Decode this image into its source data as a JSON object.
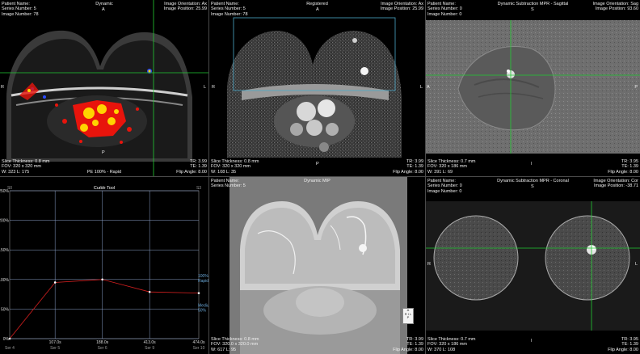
{
  "viewports": {
    "dynamic": {
      "title": "Dynamic",
      "tl": [
        "Patient Name:",
        "Series Number: 5",
        "Image Number: 78"
      ],
      "tr": [
        "Image Orientation: Ax",
        "Image Position: 25.99"
      ],
      "bl": [
        "Slice Thickness: 0.8 mm",
        "FOV: 320 x 320 mm",
        "W: 323  L: 175"
      ],
      "br": [
        "TR: 3.99",
        "TE: 1.39",
        "Flip Angle: 8.00"
      ],
      "bottom_center": "PE 100% - Rapid",
      "orient": {
        "top": "A",
        "bottom": "P",
        "left": "R",
        "right": "L"
      }
    },
    "registered": {
      "title": "Registered",
      "tl": [
        "Patient Name:",
        "Series Number: 5",
        "Image Number: 78"
      ],
      "tr": [
        "Image Orientation: Ax",
        "Image Position: 25.99"
      ],
      "bl": [
        "Slice Thickness: 0.8 mm",
        "FOV: 320 x 320 mm",
        "W: 108  L: 35"
      ],
      "br": [
        "TR: 3.99",
        "TE: 1.39",
        "Flip Angle: 8.00"
      ],
      "orient": {
        "top": "A",
        "bottom": "P",
        "left": "R",
        "right": "L"
      }
    },
    "sagittal": {
      "title": "Dynamic Subtraction MPR - Sagittal",
      "tl": [
        "Patient Name:",
        "Series Number: 0",
        "Image Number: 0"
      ],
      "tr": [
        "Image Orientation: Sag",
        "Image Position: 93.60"
      ],
      "bl": [
        "Slice Thickness: 0.7 mm",
        "FOV: 320 x 186 mm",
        "W: 391  L: 69"
      ],
      "br": [
        "TR: 3.95",
        "TE: 1.39",
        "Flip Angle: 8.00"
      ],
      "orient": {
        "top": "S",
        "bottom": "I",
        "left": "A",
        "right": "P"
      }
    },
    "curve": {
      "title": "Curve Tool",
      "legend_rapid": [
        "100%",
        "Rapid"
      ],
      "legend_medium": [
        "Medium",
        "50%"
      ]
    },
    "mip": {
      "title": "Dynamic MIP",
      "tl": [
        "Patient Name:",
        "Series Number: 5"
      ],
      "bl": [
        "Slice Thickness: 0.8 mm",
        "FOV: 320.0 x 320.0 mm",
        "W: 617  L: 95"
      ],
      "br": [
        "TR: 3.99",
        "TE: 1.39",
        "Flip Angle: 8.00"
      ],
      "cube": {
        "top": "A",
        "left": "R",
        "right": "L",
        "bottom": "P",
        "center": "I"
      }
    },
    "coronal": {
      "title": "Dynamic Subtraction MPR - Coronal",
      "tl": [
        "Patient Name:",
        "Series Number: 0",
        "Image Number: 0"
      ],
      "tr": [
        "Image Orientation: Cor",
        "Image Position: -38.71"
      ],
      "bl": [
        "Slice Thickness: 0.7 mm",
        "FOV: 320 x 186 mm",
        "W: 370  L: 108"
      ],
      "br": [
        "TR: 3.95",
        "TE: 1.39",
        "Flip Angle: 8.00"
      ],
      "orient": {
        "top": "S",
        "bottom": "I",
        "left": "R",
        "right": "L"
      }
    }
  },
  "chart_data": {
    "type": "line",
    "title": "Curve Tool",
    "x_labels": [
      {
        "time": "",
        "series": "Ser 4"
      },
      {
        "time": "107.0s",
        "series": "Ser 5"
      },
      {
        "time": "188.0s",
        "series": "Ser 6"
      },
      {
        "time": "413.0s",
        "series": "Ser 9"
      },
      {
        "time": "474.0s",
        "series": "Ser 10"
      }
    ],
    "top_labels": [
      "S0",
      "S1",
      "S3"
    ],
    "y_ticks": [
      "250%",
      "200%",
      "150%",
      "100%",
      "50%",
      "0%"
    ],
    "ylim": [
      0,
      250
    ],
    "series": [
      {
        "values": [
          0,
          95,
          100,
          79,
          77
        ]
      }
    ],
    "guides": [
      {
        "label": "100% Rapid",
        "value": 100
      },
      {
        "label": "Medium 50%",
        "value": 50
      }
    ],
    "colors": {
      "line": "#d41f1f",
      "grid": "#8aa0c8",
      "marker": "#ffffff"
    }
  },
  "colors": {
    "crosshair": "#22cc33",
    "roi": "#4aa8c8",
    "heat_red": "#e8140c",
    "heat_yellow": "#ffd400",
    "heat_blue": "#2a4cff"
  }
}
